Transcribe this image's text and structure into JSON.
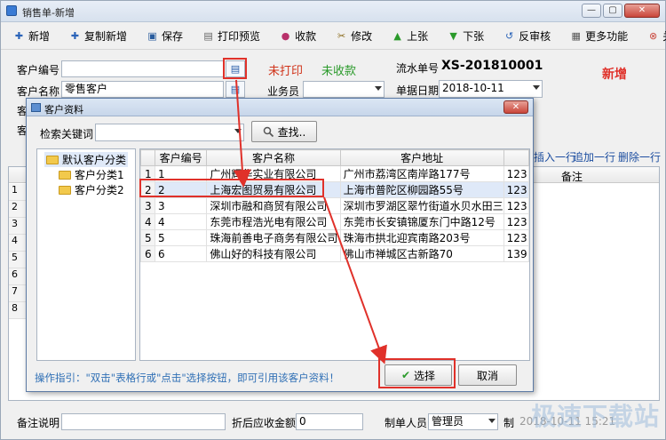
{
  "window": {
    "title": "销售单-新增",
    "min": "—",
    "max": "▢",
    "close": "✕"
  },
  "toolbar": [
    {
      "id": "new",
      "label": "新增",
      "icon": "✚"
    },
    {
      "id": "copy-new",
      "label": "复制新增",
      "icon": "✚"
    },
    {
      "id": "save",
      "label": "保存",
      "icon": "▣"
    },
    {
      "id": "print-preview",
      "label": "打印预览",
      "icon": "▤"
    },
    {
      "id": "receive",
      "label": "收款",
      "icon": "●"
    },
    {
      "id": "edit",
      "label": "修改",
      "icon": "✂"
    },
    {
      "id": "prev",
      "label": "上张",
      "icon": "▲"
    },
    {
      "id": "next",
      "label": "下张",
      "icon": "▼"
    },
    {
      "id": "unaudit",
      "label": "反审核",
      "icon": "↺"
    },
    {
      "id": "more",
      "label": "更多功能",
      "icon": "▦"
    },
    {
      "id": "close",
      "label": "关闭",
      "icon": "⊗"
    }
  ],
  "form": {
    "customer_code_label": "客户编号",
    "customer_code_value": "",
    "status_print": "未打印",
    "status_receive": "未收款",
    "serial_label": "流水单号",
    "serial_value": "XS-201810001",
    "mode": "新增",
    "customer_name_label": "客户名称",
    "customer_name_value": "零售客户",
    "salesperson_label": "业务员",
    "salesperson_value": "",
    "date_label": "单据日期",
    "date_value": "2018-10-11",
    "row3_label": "客",
    "row4_label": "客"
  },
  "grid_actions": {
    "insert_row": "插入一行",
    "append_row": "追加一行",
    "delete_row": "删除一行"
  },
  "grid_bg": {
    "remark_header": "备注",
    "row_numbers": [
      "1",
      "2",
      "3",
      "4",
      "5",
      "6",
      "7",
      "8"
    ]
  },
  "footer": {
    "remark_label": "备注说明",
    "discount_label": "折后应收金额",
    "discount_value": "0",
    "maker_label": "制单人员",
    "maker_value": "管理员",
    "time_label": "制",
    "time_value": "2018-10-11 15:21"
  },
  "dialog": {
    "title": "客户资料",
    "close": "✕",
    "search_label": "检索关键词",
    "search_value": "",
    "search_button": "查找..",
    "tree": [
      {
        "label": "默认客户分类",
        "selected": true
      },
      {
        "label": "客户分类1",
        "selected": false
      },
      {
        "label": "客户分类2",
        "selected": false
      }
    ],
    "columns": [
      "",
      "客户编号",
      "客户名称",
      "客户地址",
      ""
    ],
    "rows": [
      {
        "rn": "1",
        "code": "1",
        "name": "广州辉华实业有限公司",
        "address": "广州市荔湾区南岸路177号",
        "tel": "123"
      },
      {
        "rn": "2",
        "code": "2",
        "name": "上海宏图贸易有限公司",
        "address": "上海市普陀区柳园路55号",
        "tel": "123"
      },
      {
        "rn": "3",
        "code": "3",
        "name": "深圳市融和商贸有限公司",
        "address": "深圳市罗湖区翠竹街道水贝水田三",
        "tel": "123"
      },
      {
        "rn": "4",
        "code": "4",
        "name": "东莞市程浩光电有限公司",
        "address": "东莞市长安镇锦厦东门中路12号",
        "tel": "123"
      },
      {
        "rn": "5",
        "code": "5",
        "name": "珠海前善电子商务有限公司",
        "address": "珠海市拱北迎宾南路203号",
        "tel": "123"
      },
      {
        "rn": "6",
        "code": "6",
        "name": "佛山好的科技有限公司",
        "address": "佛山市禅城区古新路70",
        "tel": "139"
      }
    ],
    "hint": "操作指引：\"双击\"表格行或\"点击\"选择按钮，即可引用该客户资料！",
    "select_button": "选择",
    "cancel_button": "取消"
  },
  "watermark": "极速下载站",
  "colors": {
    "accent_red": "#e0312a",
    "status_green": "#2a9a2a",
    "hint_blue": "#2f6fb5",
    "selected_row": "#dfe9f8"
  }
}
